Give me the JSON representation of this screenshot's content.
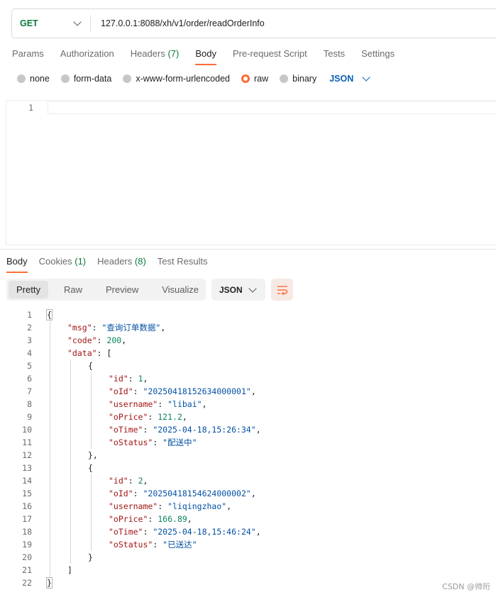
{
  "request": {
    "method": "GET",
    "url": "127.0.0.1:8088/xh/v1/order/readOrderInfo"
  },
  "request_tabs": [
    {
      "label": "Params",
      "count": ""
    },
    {
      "label": "Authorization",
      "count": ""
    },
    {
      "label": "Headers",
      "count": "(7)"
    },
    {
      "label": "Body",
      "count": ""
    },
    {
      "label": "Pre-request Script",
      "count": ""
    },
    {
      "label": "Tests",
      "count": ""
    },
    {
      "label": "Settings",
      "count": ""
    }
  ],
  "body_types": [
    "none",
    "form-data",
    "x-www-form-urlencoded",
    "raw",
    "binary"
  ],
  "body_selected": "raw",
  "body_format": "JSON",
  "request_editor": {
    "line_number": "1"
  },
  "response_tabs": [
    {
      "label": "Body",
      "count": ""
    },
    {
      "label": "Cookies",
      "count": "(1)"
    },
    {
      "label": "Headers",
      "count": "(8)"
    },
    {
      "label": "Test Results",
      "count": ""
    }
  ],
  "view_modes": [
    "Pretty",
    "Raw",
    "Preview",
    "Visualize"
  ],
  "response_format": "JSON",
  "response_lines": [
    {
      "n": "1",
      "indent": 0,
      "tokens": [
        [
          "p",
          "{"
        ]
      ]
    },
    {
      "n": "2",
      "indent": 1,
      "tokens": [
        [
          "k",
          "\"msg\""
        ],
        [
          "p",
          ": "
        ],
        [
          "s",
          "\"查询订单数据\""
        ],
        [
          "p",
          ","
        ]
      ]
    },
    {
      "n": "3",
      "indent": 1,
      "tokens": [
        [
          "k",
          "\"code\""
        ],
        [
          "p",
          ": "
        ],
        [
          "n",
          "200"
        ],
        [
          "p",
          ","
        ]
      ]
    },
    {
      "n": "4",
      "indent": 1,
      "tokens": [
        [
          "k",
          "\"data\""
        ],
        [
          "p",
          ": ["
        ]
      ]
    },
    {
      "n": "5",
      "indent": 2,
      "tokens": [
        [
          "p",
          "{"
        ]
      ]
    },
    {
      "n": "6",
      "indent": 3,
      "tokens": [
        [
          "k",
          "\"id\""
        ],
        [
          "p",
          ": "
        ],
        [
          "n",
          "1"
        ],
        [
          "p",
          ","
        ]
      ]
    },
    {
      "n": "7",
      "indent": 3,
      "tokens": [
        [
          "k",
          "\"oId\""
        ],
        [
          "p",
          ": "
        ],
        [
          "s",
          "\"20250418152634000001\""
        ],
        [
          "p",
          ","
        ]
      ]
    },
    {
      "n": "8",
      "indent": 3,
      "tokens": [
        [
          "k",
          "\"username\""
        ],
        [
          "p",
          ": "
        ],
        [
          "s",
          "\"libai\""
        ],
        [
          "p",
          ","
        ]
      ]
    },
    {
      "n": "9",
      "indent": 3,
      "tokens": [
        [
          "k",
          "\"oPrice\""
        ],
        [
          "p",
          ": "
        ],
        [
          "n",
          "121.2"
        ],
        [
          "p",
          ","
        ]
      ]
    },
    {
      "n": "10",
      "indent": 3,
      "tokens": [
        [
          "k",
          "\"oTime\""
        ],
        [
          "p",
          ": "
        ],
        [
          "s",
          "\"2025-04-18,15:26:34\""
        ],
        [
          "p",
          ","
        ]
      ]
    },
    {
      "n": "11",
      "indent": 3,
      "tokens": [
        [
          "k",
          "\"oStatus\""
        ],
        [
          "p",
          ": "
        ],
        [
          "s",
          "\"配送中\""
        ]
      ]
    },
    {
      "n": "12",
      "indent": 2,
      "tokens": [
        [
          "p",
          "},"
        ]
      ]
    },
    {
      "n": "13",
      "indent": 2,
      "tokens": [
        [
          "p",
          "{"
        ]
      ]
    },
    {
      "n": "14",
      "indent": 3,
      "tokens": [
        [
          "k",
          "\"id\""
        ],
        [
          "p",
          ": "
        ],
        [
          "n",
          "2"
        ],
        [
          "p",
          ","
        ]
      ]
    },
    {
      "n": "15",
      "indent": 3,
      "tokens": [
        [
          "k",
          "\"oId\""
        ],
        [
          "p",
          ": "
        ],
        [
          "s",
          "\"20250418154624000002\""
        ],
        [
          "p",
          ","
        ]
      ]
    },
    {
      "n": "16",
      "indent": 3,
      "tokens": [
        [
          "k",
          "\"username\""
        ],
        [
          "p",
          ": "
        ],
        [
          "s",
          "\"liqingzhao\""
        ],
        [
          "p",
          ","
        ]
      ]
    },
    {
      "n": "17",
      "indent": 3,
      "tokens": [
        [
          "k",
          "\"oPrice\""
        ],
        [
          "p",
          ": "
        ],
        [
          "n",
          "166.89"
        ],
        [
          "p",
          ","
        ]
      ]
    },
    {
      "n": "18",
      "indent": 3,
      "tokens": [
        [
          "k",
          "\"oTime\""
        ],
        [
          "p",
          ": "
        ],
        [
          "s",
          "\"2025-04-18,15:46:24\""
        ],
        [
          "p",
          ","
        ]
      ]
    },
    {
      "n": "19",
      "indent": 3,
      "tokens": [
        [
          "k",
          "\"oStatus\""
        ],
        [
          "p",
          ": "
        ],
        [
          "s",
          "\"已送达\""
        ]
      ]
    },
    {
      "n": "20",
      "indent": 2,
      "tokens": [
        [
          "p",
          "}"
        ]
      ]
    },
    {
      "n": "21",
      "indent": 1,
      "tokens": [
        [
          "p",
          "]"
        ]
      ]
    },
    {
      "n": "22",
      "indent": 0,
      "tokens": [
        [
          "p",
          "}"
        ]
      ]
    }
  ],
  "watermark": "CSDN @帅珩",
  "icons": {
    "method_dropdown": "chevron-down-icon",
    "format_dropdown": "chevron-down-icon",
    "wrap": "wrap-lines-icon"
  },
  "colors": {
    "accent": "#ff6c37",
    "method_get": "#0b7a3b",
    "json_link": "#0a5fb4"
  }
}
